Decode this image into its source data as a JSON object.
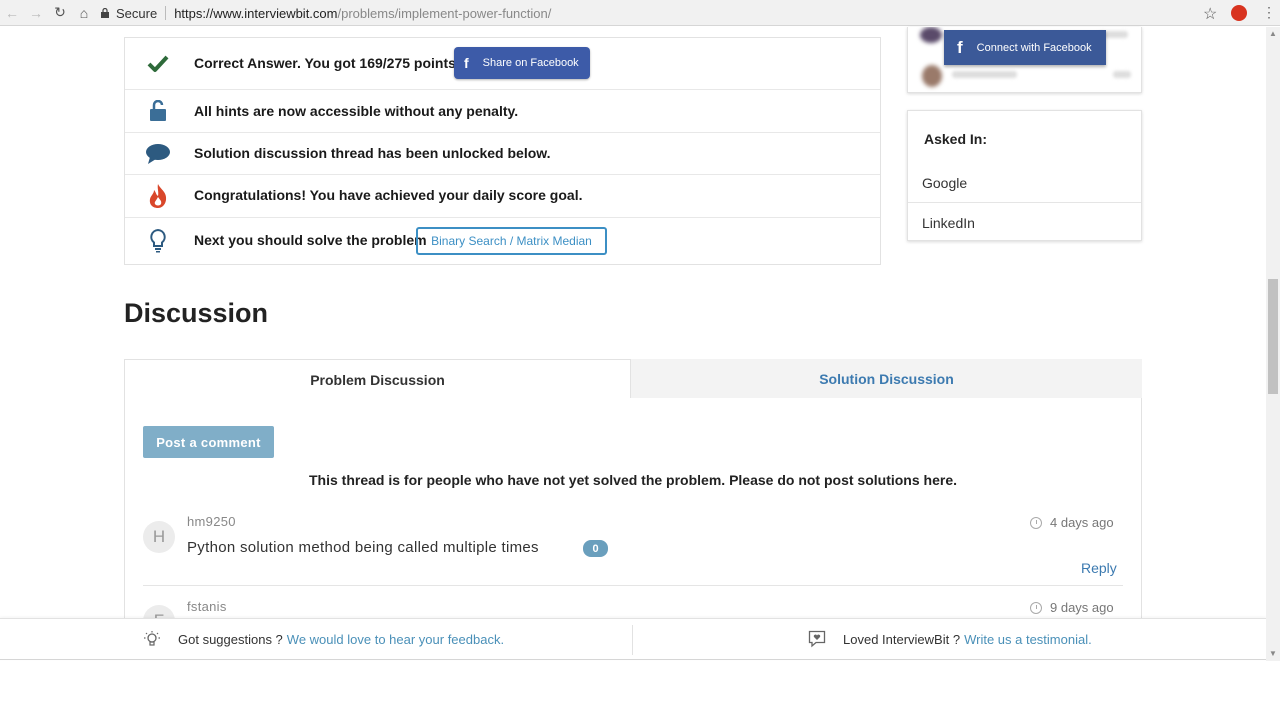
{
  "browser": {
    "secure_label": "Secure",
    "url_host": "https://www.interviewbit.com",
    "url_path": "/problems/implement-power-function/"
  },
  "result": {
    "rows": [
      {
        "text": "Correct Answer. You got 169/275 points!",
        "icon": "checkmark-icon"
      },
      {
        "text": "All hints are now accessible without any penalty.",
        "icon": "unlocked-padlock-icon"
      },
      {
        "text": "Solution discussion thread has been unlocked below.",
        "icon": "speech-bubble-icon"
      },
      {
        "text": "Congratulations! You have achieved your daily score goal.",
        "icon": "flame-icon"
      },
      {
        "text": "Next you should solve the problem",
        "icon": "lightbulb-icon"
      }
    ],
    "share_facebook": "Share on Facebook",
    "next_problem": "Binary Search / Matrix Median"
  },
  "sidebar": {
    "connect_facebook": "Connect with Facebook",
    "asked_in_title": "Asked In:",
    "companies": [
      "Google",
      "LinkedIn"
    ]
  },
  "discussion": {
    "title": "Discussion",
    "tabs": [
      "Problem Discussion",
      "Solution Discussion"
    ],
    "post_comment": "Post a comment",
    "notice": "This thread is for people who have not yet solved the problem. Please do not post solutions here.",
    "comments": [
      {
        "initial": "H",
        "user": "hm9250",
        "time": "4 days ago",
        "title": "Python solution method being called multiple times",
        "count": "0",
        "reply": "Reply"
      },
      {
        "initial": "F",
        "user": "fstanis",
        "time": "9 days ago"
      }
    ]
  },
  "feedback": {
    "left_text": "Got suggestions ?",
    "left_link": "We would love to hear your feedback.",
    "right_text": "Loved InterviewBit ?",
    "right_link": "Write us a testimonial."
  },
  "colors": {
    "facebook": "#3b5998",
    "accent_blue": "#3c8fc4",
    "post_button": "#80aec8",
    "badge": "#6a9fbd",
    "flame": "#d9472b",
    "check": "#2e6a3a"
  }
}
